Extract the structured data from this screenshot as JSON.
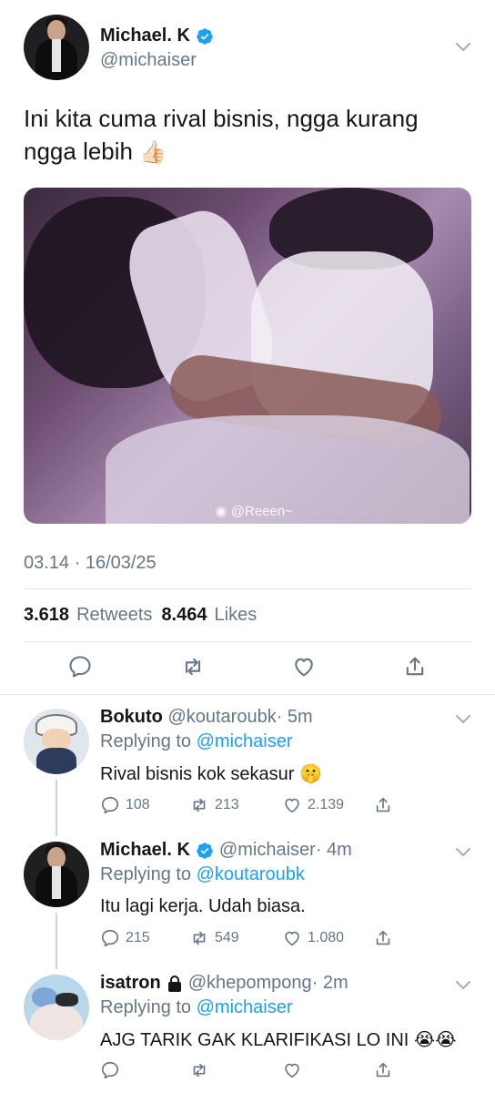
{
  "main_tweet": {
    "author_name": "Michael. K",
    "author_handle": "@michaiser",
    "text": "Ini kita cuma rival bisnis, ngga kurang ngga lebih",
    "text_emoji": "👍🏻",
    "media_watermark": "@Reeen~",
    "timestamp": "03.14 · 16/03/25",
    "retweets_count": "3.618",
    "retweets_label": "Retweets",
    "likes_count": "8.464",
    "likes_label": "Likes"
  },
  "replies": [
    {
      "name": "Bokuto",
      "handle": "@koutaroubk",
      "time": "· 5m",
      "replying_label": "Replying to",
      "replying_to": "@michaiser",
      "text": "Rival bisnis kok sekasur",
      "emoji": "🤫",
      "reply_count": "108",
      "retweet_count": "213",
      "like_count": "2.139"
    },
    {
      "name": "Michael. K",
      "handle": "@michaiser",
      "time": "· 4m",
      "replying_label": "Replying to",
      "replying_to": "@koutaroubk",
      "text": "Itu lagi kerja. Udah biasa.",
      "reply_count": "215",
      "retweet_count": "549",
      "like_count": "1.080"
    },
    {
      "name": "isatron",
      "handle": "@khepompong",
      "time": "· 2m",
      "replying_label": "Replying to",
      "replying_to": "@michaiser",
      "text": "AJG TARIK GAK KLARIFIKASI LO INI",
      "emoji": "😭😭"
    }
  ],
  "icons": {
    "verified": "verified-badge-icon",
    "lock": "lock-icon",
    "reply": "reply-icon",
    "retweet": "retweet-icon",
    "like": "heart-icon",
    "share": "share-icon",
    "more": "chevron-down-icon"
  },
  "colors": {
    "accent": "#1da1f2",
    "secondary_text": "#657786",
    "primary_text": "#14171a",
    "divider": "#e1e8ed"
  }
}
